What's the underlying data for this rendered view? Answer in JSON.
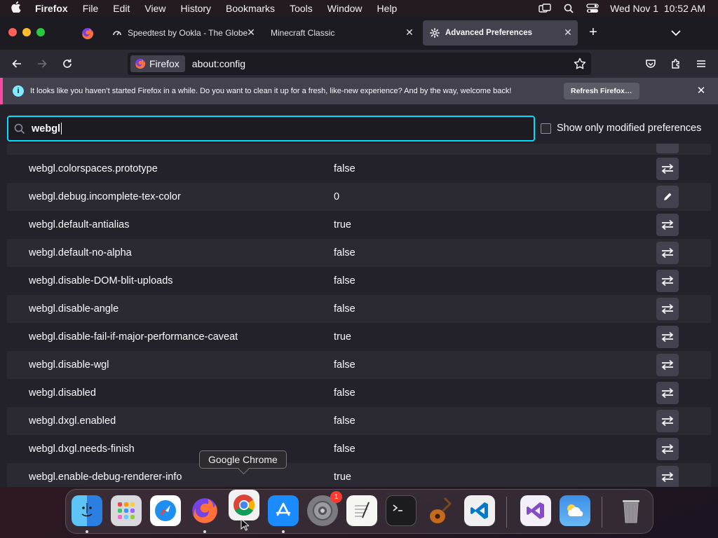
{
  "menubar": {
    "app_name": "Firefox",
    "items": [
      "File",
      "Edit",
      "View",
      "History",
      "Bookmarks",
      "Tools",
      "Window",
      "Help"
    ],
    "datetime": "Wed Nov 1  10:52 AM"
  },
  "tabs": [
    {
      "title": "Speedtest by Ookla - The Globe",
      "icon": "speedtest-icon"
    },
    {
      "title": "Minecraft Classic",
      "icon": ""
    },
    {
      "title": "Advanced Preferences",
      "icon": "gear-icon",
      "active": true
    }
  ],
  "navbar": {
    "identity_label": "Firefox",
    "url": "about:config"
  },
  "notification": {
    "message": "It looks like you haven’t started Firefox in a while. Do you want to clean it up for a fresh, like-new experience? And by the way, welcome back!",
    "button": "Refresh Firefox…"
  },
  "search": {
    "value": "webgl"
  },
  "modified_only": {
    "label": "Show only modified preferences",
    "checked": false
  },
  "prefs": [
    {
      "name": "webgl.colorspaces.prototype",
      "value": "false",
      "action": "toggle"
    },
    {
      "name": "webgl.debug.incomplete-tex-color",
      "value": "0",
      "action": "edit"
    },
    {
      "name": "webgl.default-antialias",
      "value": "true",
      "action": "toggle"
    },
    {
      "name": "webgl.default-no-alpha",
      "value": "false",
      "action": "toggle"
    },
    {
      "name": "webgl.disable-DOM-blit-uploads",
      "value": "false",
      "action": "toggle"
    },
    {
      "name": "webgl.disable-angle",
      "value": "false",
      "action": "toggle"
    },
    {
      "name": "webgl.disable-fail-if-major-performance-caveat",
      "value": "true",
      "action": "toggle"
    },
    {
      "name": "webgl.disable-wgl",
      "value": "false",
      "action": "toggle"
    },
    {
      "name": "webgl.disabled",
      "value": "false",
      "action": "toggle"
    },
    {
      "name": "webgl.dxgl.enabled",
      "value": "false",
      "action": "toggle"
    },
    {
      "name": "webgl.dxgl.needs-finish",
      "value": "false",
      "action": "toggle"
    },
    {
      "name": "webgl.enable-debug-renderer-info",
      "value": "true",
      "action": "toggle"
    }
  ],
  "dock": {
    "tooltip": "Google Chrome",
    "apps": [
      "finder-icon",
      "launchpad-icon",
      "safari-icon",
      "firefox-icon",
      "chrome-icon",
      "app-store-icon",
      "system-settings-icon",
      "textedit-icon",
      "terminal-icon",
      "garageband-icon",
      "vscode-icon",
      "visual-studio-icon",
      "weather-icon",
      "trash-icon"
    ],
    "settings_badge": "1"
  },
  "colors": {
    "accent": "#00ddff",
    "background": "#23222b",
    "row_alt": "#2b2a33",
    "notification_stripe": "#ff4aa2"
  }
}
